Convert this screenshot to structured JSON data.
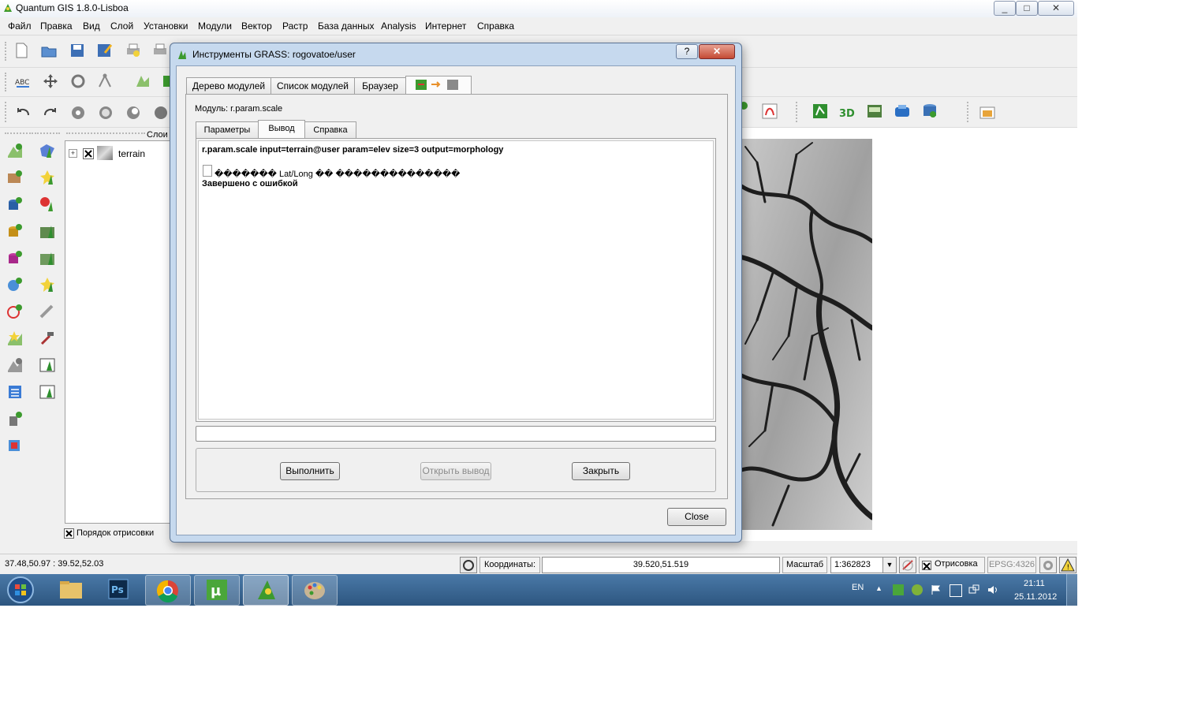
{
  "app": {
    "title": "Quantum GIS 1.8.0-Lisboa",
    "window_controls": [
      "_",
      "□",
      "✕"
    ]
  },
  "menu": [
    "Файл",
    "Правка",
    "Вид",
    "Слой",
    "Установки",
    "Модули",
    "Вектор",
    "Растр",
    "База данных",
    "Analysis",
    "Интернет",
    "Справка"
  ],
  "layers_panel": {
    "title": "Слои",
    "layer_name": "terrain",
    "render_order_label": "Порядок отрисовки"
  },
  "status": {
    "extent": "37.48,50.97 : 39.52,52.03",
    "coords_label": "Координаты:",
    "coords_value": "39.520,51.519",
    "scale_label": "Масштаб",
    "scale_value": "1:362823",
    "render_label": "Отрисовка",
    "epsg": "EPSG:4326"
  },
  "taskbar": {
    "lang": "EN",
    "time": "21:11",
    "date": "25.11.2012"
  },
  "dialog": {
    "title": "Инструменты GRASS: rogovatoe/user",
    "help_btn": "?",
    "close_x": "✕",
    "tabs": [
      "Дерево модулей",
      "Список модулей",
      "Браузер"
    ],
    "module_label": "Модуль: r.param.scale",
    "subtabs": [
      "Параметры",
      "Вывод",
      "Справка"
    ],
    "output_lines": [
      "r.param.scale input=terrain@user param=elev size=3 output=morphology",
      "������� Lat/Long �� ��������������",
      "Завершено с ошибкой"
    ],
    "run_btn": "Выполнить",
    "open_output_btn": "Открыть вывод",
    "close_btn": "Закрыть",
    "footer_close_btn": "Close"
  },
  "colors": {
    "accent": "#3a7bd5",
    "qgis_green": "#3c9a2e",
    "taskbar": "#2d5680"
  }
}
